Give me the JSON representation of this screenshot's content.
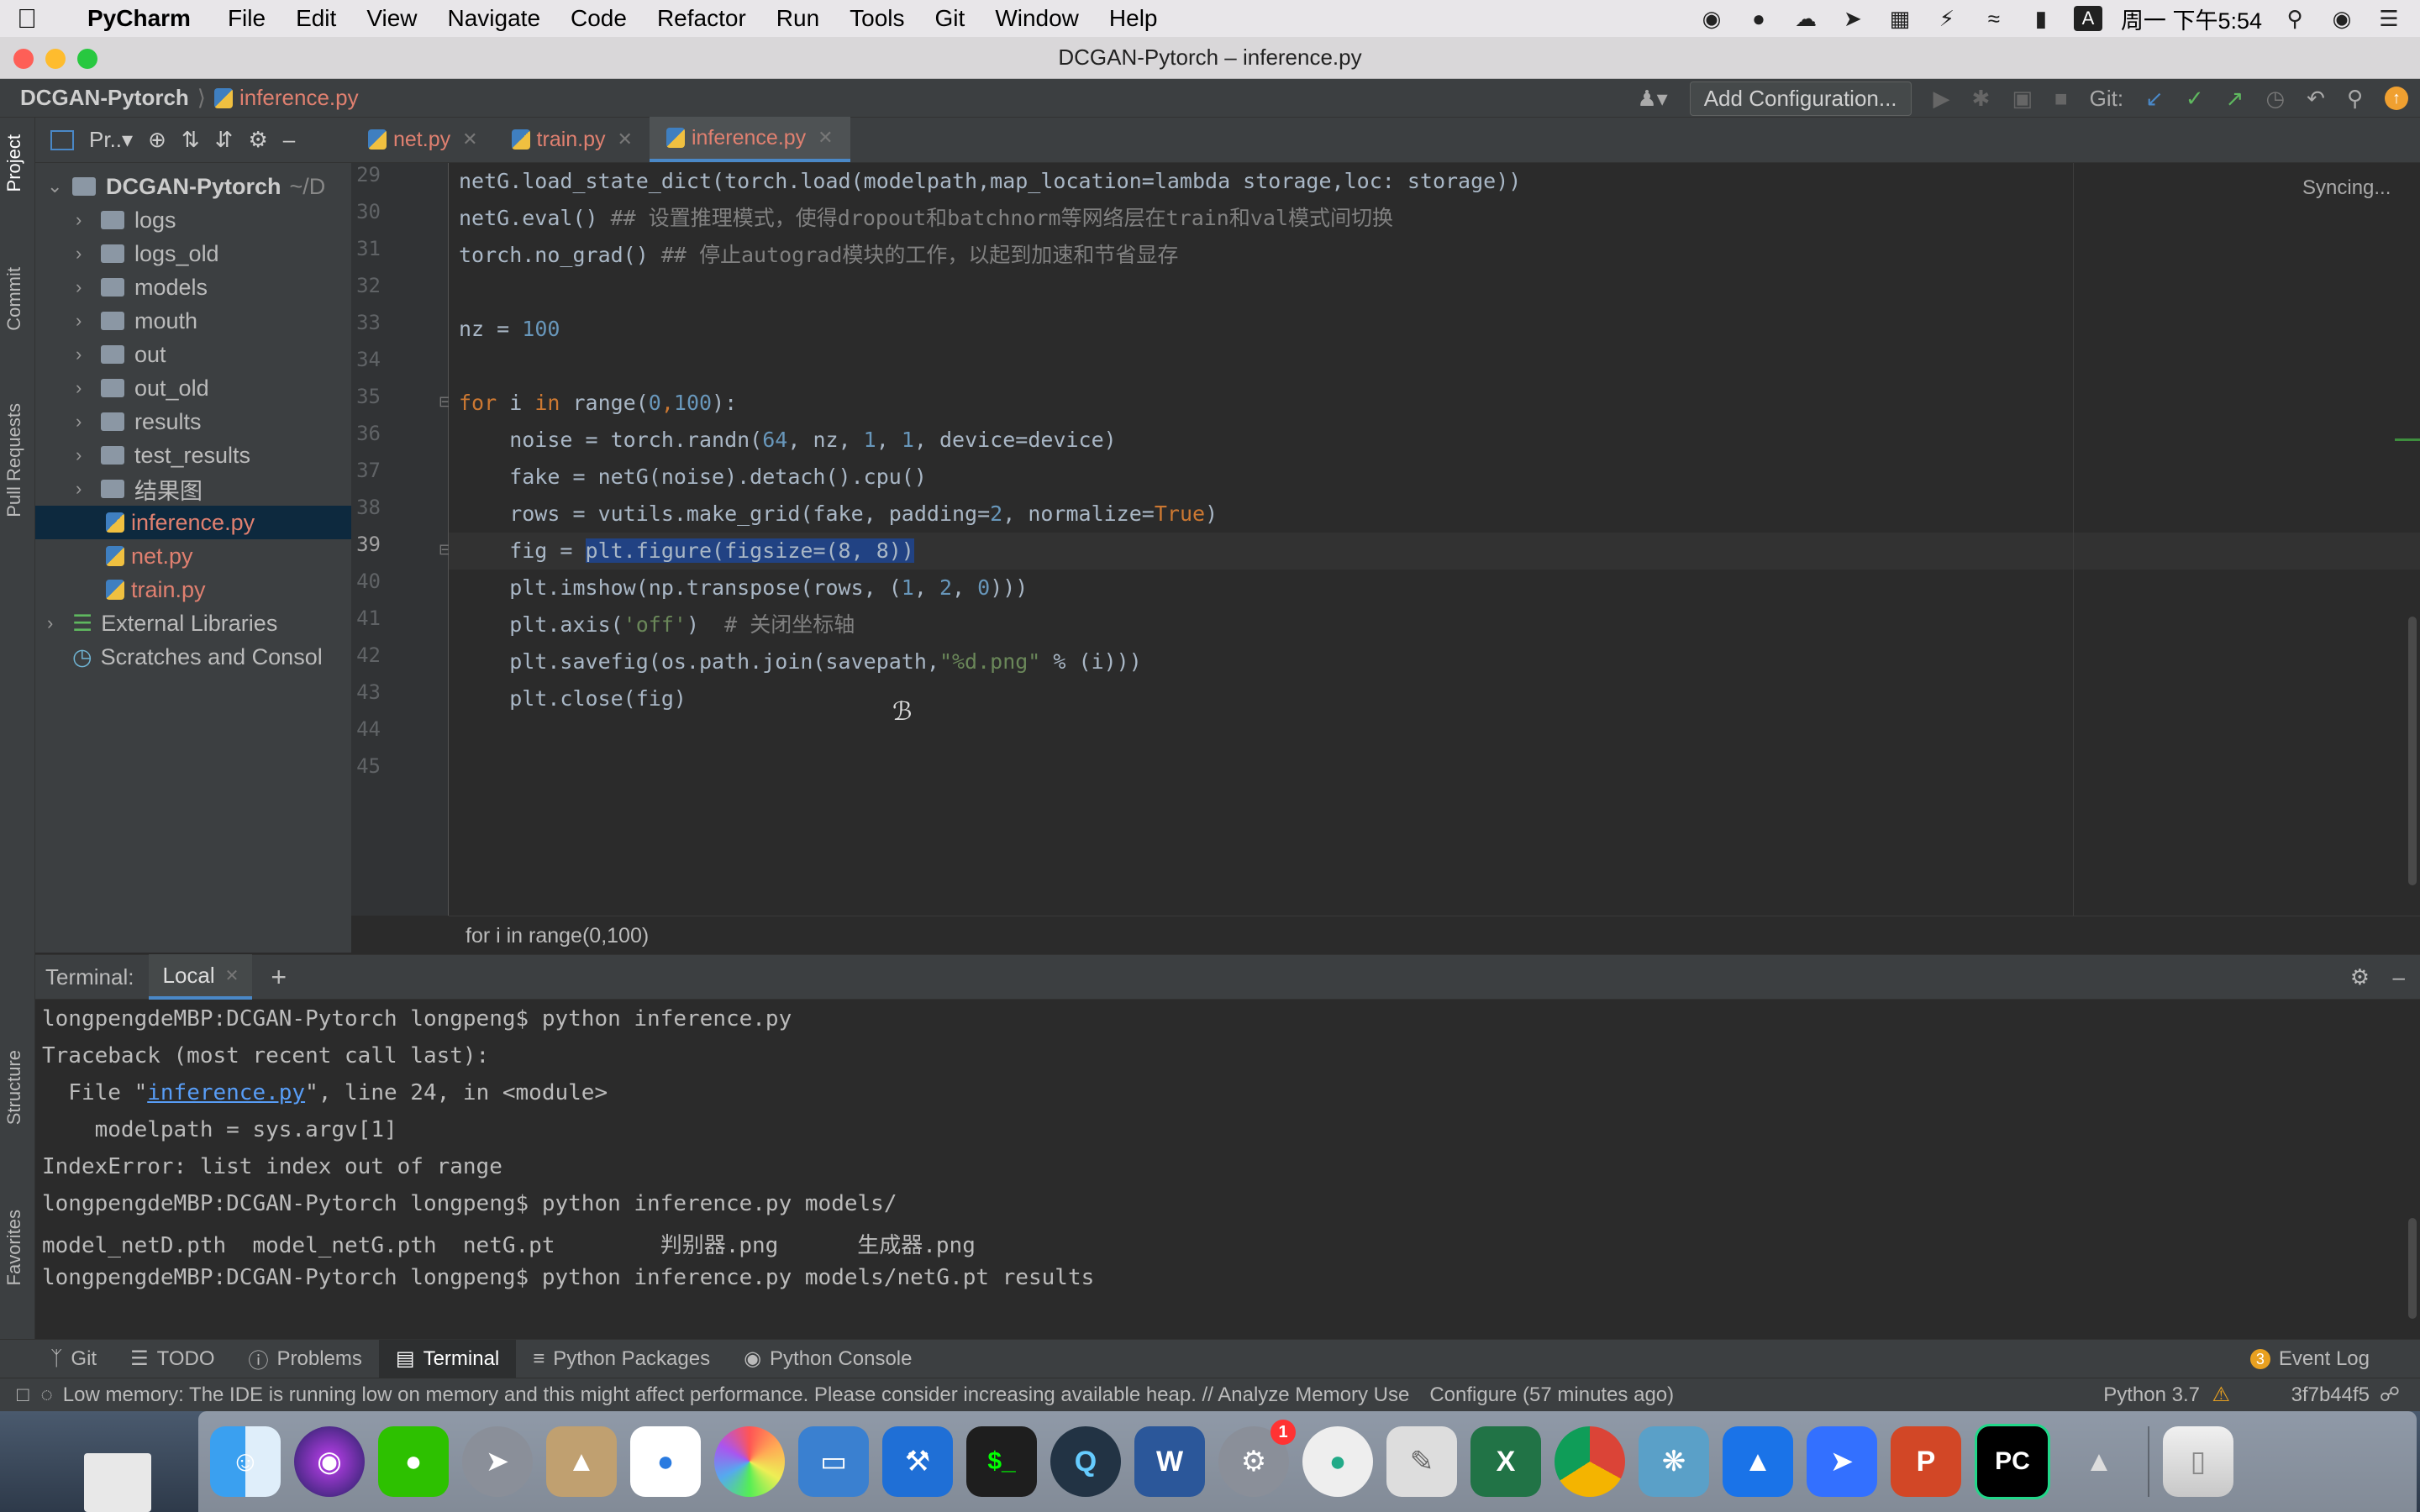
{
  "menubar": {
    "app": "PyCharm",
    "items": [
      "File",
      "Edit",
      "View",
      "Navigate",
      "Code",
      "Refactor",
      "Run",
      "Tools",
      "Git",
      "Window",
      "Help"
    ],
    "clock": "周一 下午5:54",
    "input_method": "A"
  },
  "window": {
    "title": "DCGAN-Pytorch – inference.py"
  },
  "navbar": {
    "project": "DCGAN-Pytorch",
    "file": "inference.py",
    "add_configuration": "Add Configuration...",
    "git_label": "Git:"
  },
  "side_tabs": {
    "project": "Project",
    "commit": "Commit",
    "pull_requests": "Pull Requests",
    "structure": "Structure",
    "favorites": "Favorites"
  },
  "project_panel": {
    "header": "Pr..▾",
    "root": "DCGAN-Pytorch",
    "root_path": "~/D",
    "folders": [
      "logs",
      "logs_old",
      "models",
      "mouth",
      "out",
      "out_old",
      "results",
      "test_results",
      "结果图"
    ],
    "files": [
      "inference.py",
      "net.py",
      "train.py"
    ],
    "external": "External Libraries",
    "scratches": "Scratches and Consol"
  },
  "editor_tabs": [
    {
      "label": "net.py"
    },
    {
      "label": "train.py"
    },
    {
      "label": "inference.py",
      "active": true
    }
  ],
  "editor": {
    "status": "Syncing...",
    "line_numbers": [
      "29",
      "30",
      "31",
      "32",
      "33",
      "34",
      "35",
      "36",
      "37",
      "38",
      "39",
      "40",
      "41",
      "42",
      "43",
      "44",
      "45"
    ],
    "current_line": "39",
    "breadcrumb": "for i in range(0,100)",
    "code": {
      "l29": "netG.load_state_dict(torch.load(modelpath,map_location=lambda storage,loc: storage))",
      "l30a": "netG.eval() ",
      "l30b": "## 设置推理模式，使得dropout和batchnorm等网络层在train和val模式间切换",
      "l31a": "torch.no_grad() ",
      "l31b": "## 停止autograd模块的工作，以起到加速和节省显存",
      "l33a": "nz = ",
      "l33b": "100",
      "l35a": "for",
      "l35b": " i ",
      "l35c": "in",
      "l35d": " range(",
      "l35e": "0",
      "l35f": ",",
      "l35g": "100",
      "l35h": "):",
      "l36a": "    noise = torch.randn(",
      "l36b": "64",
      "l36c": ", nz, ",
      "l36d": "1",
      "l36e": ", ",
      "l36f": "1",
      "l36g": ", device=device)",
      "l37": "    fake = netG(noise).detach().cpu()",
      "l38a": "    rows = vutils.make_grid(fake, padding=",
      "l38b": "2",
      "l38c": ", normalize=",
      "l38d": "True",
      "l38e": ")",
      "l39a": "    fig = ",
      "l39b": "plt.figure(figsize=(8, 8))",
      "l40a": "    plt.imshow(np.transpose(rows, (",
      "l40b": "1",
      "l40c": ", ",
      "l40d": "2",
      "l40e": ", ",
      "l40f": "0",
      "l40g": ")))",
      "l41a": "    plt.axis(",
      "l41b": "'off'",
      "l41c": ")  ",
      "l41d": "# 关闭坐标轴",
      "l42a": "    plt.savefig(os.path.join(savepath,",
      "l42b": "\"%d.png\"",
      "l42c": " % (i)))",
      "l43": "    plt.close(fig)"
    }
  },
  "terminal": {
    "title": "Terminal:",
    "tab": "Local",
    "lines": {
      "t1": "longpengdeMBP:DCGAN-Pytorch longpeng$ python inference.py",
      "t2": "Traceback (most recent call last):",
      "t3a": "  File \"",
      "t3b": "inference.py",
      "t3c": "\", line 24, in <module>",
      "t4": "    modelpath = sys.argv[1]",
      "t5": "IndexError: list index out of range",
      "t6": "longpengdeMBP:DCGAN-Pytorch longpeng$ python inference.py models/",
      "t7": "model_netD.pth  model_netG.pth  netG.pt        判别器.png      生成器.png",
      "t8": "longpengdeMBP:DCGAN-Pytorch longpeng$ python inference.py models/netG.pt results"
    }
  },
  "tool_tabs": [
    "Git",
    "TODO",
    "Problems",
    "Terminal",
    "Python Packages",
    "Python Console"
  ],
  "event_log": "Event Log",
  "event_count": "3",
  "status": {
    "message": "Low memory: The IDE is running low on memory and this might affect performance. Please consider increasing available heap. // Analyze Memory Use",
    "configure": "Configure (57 minutes ago)",
    "python": "Python 3.7",
    "git_hash": "3f7b44f5"
  },
  "dock": {
    "badge": "1",
    "word_letter": "W",
    "excel_letter": "X",
    "ppt_letter": "P",
    "pycharm_letter": "PC",
    "terminal_glyph": "$_"
  },
  "colors": {
    "accent": "#4a88c7",
    "editor_bg": "#2b2b2b",
    "panel_bg": "#3c3f41",
    "keyword": "#cc7832",
    "number": "#6897bb",
    "string": "#6a8759"
  }
}
